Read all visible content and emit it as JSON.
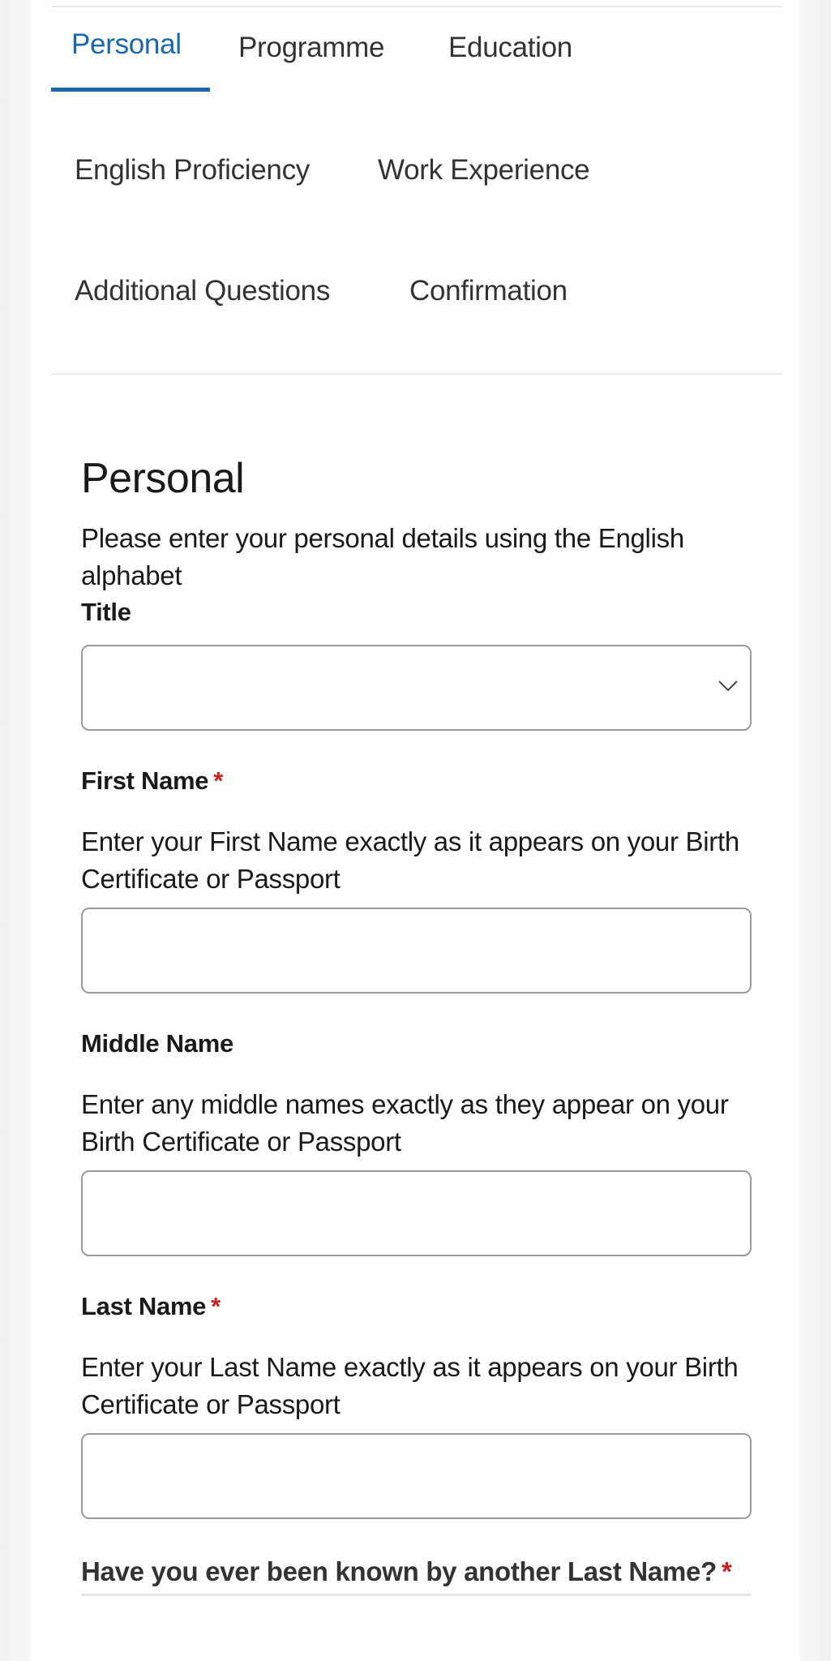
{
  "tabs": [
    {
      "label": "Personal",
      "active": true
    },
    {
      "label": "Programme",
      "active": false
    },
    {
      "label": "Education",
      "active": false
    },
    {
      "label": "English Proficiency",
      "active": false
    },
    {
      "label": "Work Experience",
      "active": false
    },
    {
      "label": "Additional Questions",
      "active": false
    },
    {
      "label": "Confirmation",
      "active": false
    }
  ],
  "section": {
    "title": "Personal",
    "intro": "Please enter your personal details using the English alphabet"
  },
  "fields": {
    "title": {
      "label": "Title",
      "selected_value": "",
      "icon": "chevron-down-icon"
    },
    "first_name": {
      "label": "First Name",
      "required_marker": "*",
      "help": "Enter your First Name exactly as it appears on your Birth Certificate or Passport",
      "value": ""
    },
    "middle_name": {
      "label": "Middle Name",
      "help": "Enter any middle names exactly as they appear on your Birth Certificate or Passport",
      "value": ""
    },
    "last_name": {
      "label": "Last Name",
      "required_marker": "*",
      "help": "Enter your Last Name exactly as it appears on your Birth Certificate or Passport",
      "value": ""
    },
    "other_last_name": {
      "label": "Have you ever been known by another Last Name?",
      "required_marker": "*"
    }
  },
  "colors": {
    "accent": "#1a67ad",
    "required": "#cc1f1f",
    "border": "#9a9a9a"
  }
}
